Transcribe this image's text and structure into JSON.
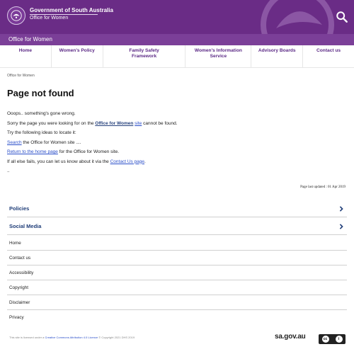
{
  "header": {
    "gov_name": "Government of South Australia",
    "office_name": "Office for Women",
    "brand_color": "#6a2c86",
    "search_icon": "search-icon"
  },
  "subbar": {
    "label": "Office for Women"
  },
  "nav": {
    "items": [
      {
        "label": "Home"
      },
      {
        "label": "Women's Policy"
      },
      {
        "label": "Family Safety Framework"
      },
      {
        "label": "Women's Information Service"
      },
      {
        "label": "Advisory Boards"
      },
      {
        "label": "Contact us"
      }
    ]
  },
  "breadcrumb": "Office for Women",
  "page_title": "Page not found",
  "content": {
    "line1": "Ooops.. something's gone wrong.",
    "line2_before": "Sorry the page you were looking for on the ",
    "line2_link": "Office for Women",
    "line2_link2": "site",
    "line2_after": " cannot be found.",
    "line3": "Try the following ideas to locate it:",
    "line4_link": "Search",
    "line4_after": " the Office for Women site ....",
    "line5_link": "Return to the home page",
    "line5_after": " for the Office for Women site.",
    "line6_before": "If all else fails, you can let us know about it via the ",
    "line6_link": "Contact Us page",
    "line6_after": ".",
    "line7": ".."
  },
  "updated": "Page last updated : 01 Apr 2019",
  "accordions": [
    {
      "label": "Policies"
    },
    {
      "label": "Social Media"
    }
  ],
  "footer_links": [
    "Home",
    "Contact us",
    "Accessibility",
    "Copyright",
    "Disclaimer",
    "Privacy"
  ],
  "footer": {
    "licence_before": "This site is licensed under a ",
    "licence_link": "Creative Commons Attribution 4.0 Licence",
    "licence_after": " © Copyright 2021 DHS 2019",
    "sagov": "sa.gov.au"
  }
}
